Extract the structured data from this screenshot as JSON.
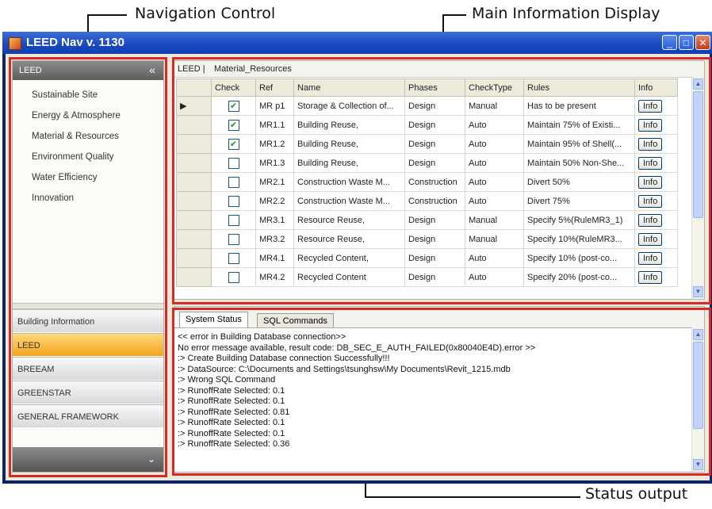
{
  "annotations": {
    "navigation": "Navigation Control",
    "main": "Main Information Display",
    "status": "Status output"
  },
  "window": {
    "title": "LEED Nav v. 1130",
    "buttons": {
      "minimize": "_",
      "maximize": "□",
      "close": "✕"
    }
  },
  "nav": {
    "header": "LEED",
    "collapse_icon": "«",
    "items": [
      {
        "label": "Sustainable Site"
      },
      {
        "label": "Energy & Atmosphere"
      },
      {
        "label": "Material & Resources"
      },
      {
        "label": "Environment Quality"
      },
      {
        "label": "Water Efficiency"
      },
      {
        "label": "Innovation"
      }
    ],
    "buttons": [
      {
        "label": "Building Information"
      },
      {
        "label": "LEED"
      },
      {
        "label": "BREEAM"
      },
      {
        "label": "GREENSTAR"
      },
      {
        "label": "GENERAL FRAMEWORK"
      }
    ],
    "active_button": "LEED",
    "expand_icon": "⌄"
  },
  "main": {
    "breadcrumb_root": "LEED |",
    "breadcrumb_page": "Material_Resources",
    "columns": [
      "Check",
      "Ref",
      "Name",
      "Phases",
      "CheckType",
      "Rules",
      "Info"
    ],
    "rows": [
      {
        "checked": true,
        "ref": "MR p1",
        "name": "Storage & Collection of...",
        "phase": "Design",
        "type": "Manual",
        "rule": "Has to be present",
        "info": "Info"
      },
      {
        "checked": true,
        "ref": "MR1.1",
        "name": "Building Reuse,",
        "phase": "Design",
        "type": "Auto",
        "rule": "Maintain 75% of Existi...",
        "info": "Info"
      },
      {
        "checked": true,
        "ref": "MR1.2",
        "name": "Building Reuse,",
        "phase": "Design",
        "type": "Auto",
        "rule": "Maintain 95% of Shell(...",
        "info": "Info"
      },
      {
        "checked": false,
        "ref": "MR1.3",
        "name": "Building Reuse,",
        "phase": "Design",
        "type": "Auto",
        "rule": "Maintain 50% Non-She...",
        "info": "Info"
      },
      {
        "checked": false,
        "ref": "MR2.1",
        "name": "Construction Waste M...",
        "phase": "Construction",
        "type": "Auto",
        "rule": "Divert 50%",
        "info": "Info"
      },
      {
        "checked": false,
        "ref": "MR2.2",
        "name": "Construction Waste M...",
        "phase": "Construction",
        "type": "Auto",
        "rule": "Divert 75%",
        "info": "Info"
      },
      {
        "checked": false,
        "ref": "MR3.1",
        "name": "Resource Reuse,",
        "phase": "Design",
        "type": "Manual",
        "rule": "Specify 5%(RuleMR3_1)",
        "info": "Info"
      },
      {
        "checked": false,
        "ref": "MR3.2",
        "name": "Resource Reuse,",
        "phase": "Design",
        "type": "Manual",
        "rule": "Specify 10%(RuleMR3...",
        "info": "Info"
      },
      {
        "checked": false,
        "ref": "MR4.1",
        "name": "Recycled Content,",
        "phase": "Design",
        "type": "Auto",
        "rule": "Specify 10% (post-co...",
        "info": "Info"
      },
      {
        "checked": false,
        "ref": "MR4.2",
        "name": "Recycled Content",
        "phase": "Design",
        "type": "Auto",
        "rule": "Specify 20% (post-co...",
        "info": "Info"
      }
    ]
  },
  "status": {
    "tabs": [
      "System Status",
      "SQL Commands"
    ],
    "log": [
      "<< error in Building Database connection>>",
      "No error message available, result code: DB_SEC_E_AUTH_FAILED(0x80040E4D).error >>",
      ":> Create Building Database connection Successfully!!!",
      ":> DataSource: C:\\Documents and Settings\\tsunghsw\\My Documents\\Revit_1215.mdb",
      ":> Wrong SQL Command",
      " :> RunoffRate Selected: 0.1",
      ":> RunoffRate Selected: 0.1",
      ":> RunoffRate Selected: 0.81",
      ":> RunoffRate Selected: 0.1",
      ":> RunoffRate Selected: 0.1",
      ":> RunoffRate Selected: 0.36"
    ]
  },
  "colors": {
    "highlight_frame": "#d8292a",
    "active_nav": "#f3a51c"
  }
}
